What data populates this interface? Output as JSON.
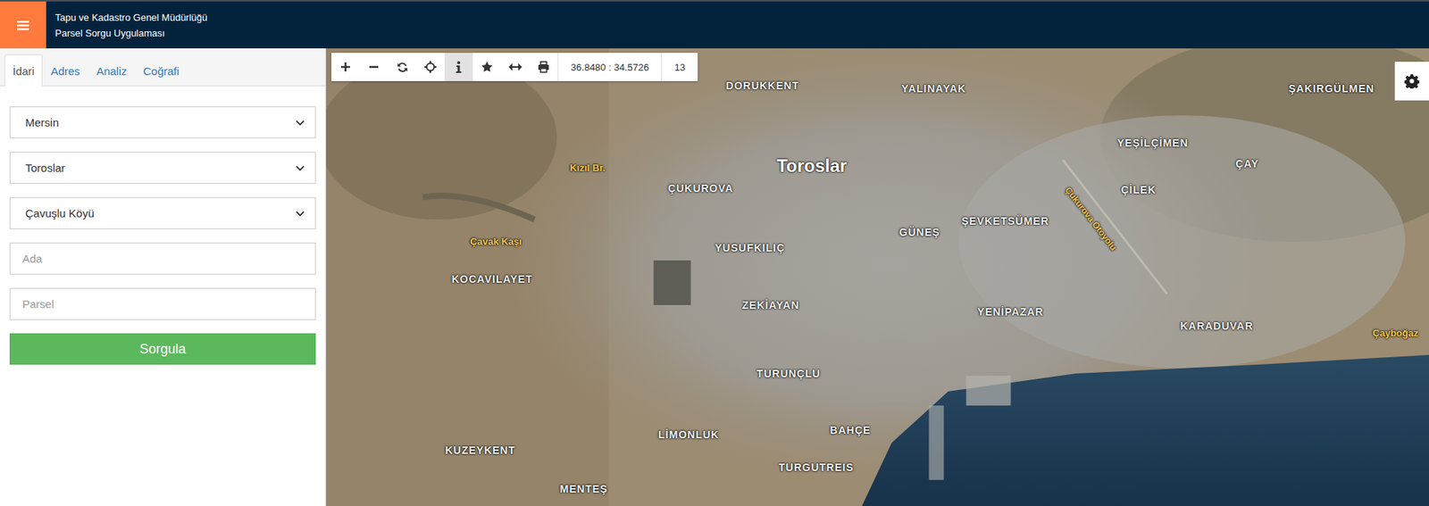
{
  "header": {
    "menu_icon": "☰",
    "title_line1": "Tapu ve Kadastro Genel Müdürlüğü",
    "title_line2": "Parsel Sorgu Uygulaması"
  },
  "tabs": [
    {
      "label": "İdari",
      "selected": true
    },
    {
      "label": "Adres",
      "selected": false
    },
    {
      "label": "Analiz",
      "selected": false
    },
    {
      "label": "Coğrafi",
      "selected": false
    }
  ],
  "form": {
    "selects": [
      {
        "value": "Mersin"
      },
      {
        "value": "Toroslar"
      },
      {
        "value": "Çavuşlu Köyü"
      }
    ],
    "inputs": [
      {
        "placeholder": "Ada"
      },
      {
        "placeholder": "Parsel"
      }
    ],
    "button": "Sorgula"
  },
  "toolbar": {
    "tools": [
      {
        "selected": false
      },
      {
        "selected": false
      },
      {
        "selected": false
      },
      {
        "selected": false
      },
      {
        "selected": true
      },
      {
        "selected": false
      },
      {
        "selected": false
      },
      {
        "selected": false
      }
    ],
    "coordinates": "36.8480 : 34.5726",
    "zoom": "13"
  },
  "map": {
    "labels": [
      {
        "text": "DORUKKENT",
        "kind": "neighborhood"
      },
      {
        "text": "YALINAYAK",
        "kind": "neighborhood"
      },
      {
        "text": "ŞAKIRGÜLMEN",
        "kind": "neighborhood"
      },
      {
        "text": "Toroslar",
        "kind": "district"
      },
      {
        "text": "Kızıl Br.",
        "kind": "poi"
      },
      {
        "text": "ÇUKUROVA",
        "kind": "neighborhood"
      },
      {
        "text": "YEŞİLÇİMEN",
        "kind": "neighborhood"
      },
      {
        "text": "ÇAY",
        "kind": "neighborhood"
      },
      {
        "text": "ÇİLEK",
        "kind": "neighborhood"
      },
      {
        "text": "ŞEVKETSÜMER",
        "kind": "neighborhood"
      },
      {
        "text": "GÜNEŞ",
        "kind": "neighborhood"
      },
      {
        "text": "Çukurova Otoyolu",
        "kind": "road"
      },
      {
        "text": "Çavak Kaşı",
        "kind": "poi"
      },
      {
        "text": "YUSUFKILIÇ",
        "kind": "neighborhood"
      },
      {
        "text": "KOCAVILAYET",
        "kind": "neighborhood"
      },
      {
        "text": "ZEKİAYAN",
        "kind": "neighborhood"
      },
      {
        "text": "YENİPAZAR",
        "kind": "neighborhood"
      },
      {
        "text": "KARADUVAR",
        "kind": "neighborhood"
      },
      {
        "text": "Çayboğaz",
        "kind": "poi"
      },
      {
        "text": "TURUNÇLU",
        "kind": "neighborhood"
      },
      {
        "text": "BAHÇE",
        "kind": "neighborhood"
      },
      {
        "text": "LİMONLUK",
        "kind": "neighborhood"
      },
      {
        "text": "KUZEYKENT",
        "kind": "neighborhood"
      },
      {
        "text": "TURGUTREIS",
        "kind": "neighborhood"
      },
      {
        "text": "MENTEŞ",
        "kind": "neighborhood"
      }
    ]
  }
}
